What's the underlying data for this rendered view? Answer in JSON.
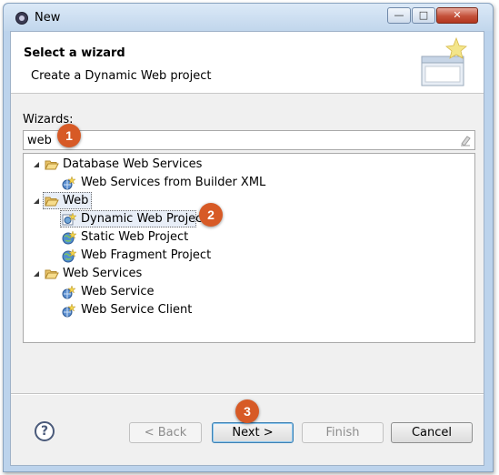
{
  "window": {
    "title": "New"
  },
  "header": {
    "title": "Select a wizard",
    "description": "Create a Dynamic Web project"
  },
  "wizards": {
    "label": "Wizards:",
    "filter_value": "web"
  },
  "tree": {
    "items": [
      {
        "label": "Database Web Services",
        "icon": "folder-open-icon",
        "expanded": true
      },
      {
        "label": "Web Services from Builder XML",
        "icon": "web-service-wizard-icon"
      },
      {
        "label": "Web",
        "icon": "folder-open-icon",
        "expanded": true
      },
      {
        "label": "Dynamic Web Project",
        "icon": "dynamic-web-project-icon",
        "selected": true
      },
      {
        "label": "Static Web Project",
        "icon": "static-web-project-icon"
      },
      {
        "label": "Web Fragment Project",
        "icon": "web-fragment-project-icon"
      },
      {
        "label": "Web Services",
        "icon": "folder-open-icon",
        "expanded": true
      },
      {
        "label": "Web Service",
        "icon": "web-service-wizard-icon"
      },
      {
        "label": "Web Service Client",
        "icon": "web-service-wizard-icon"
      }
    ]
  },
  "buttons": {
    "help": "?",
    "back": "< Back",
    "next": "Next >",
    "finish": "Finish",
    "cancel": "Cancel"
  },
  "callouts": [
    "1",
    "2",
    "3"
  ],
  "colors": {
    "callout": "#d75a26",
    "title_bar": "#c1d6ec",
    "default_button_border": "#3c7fb1"
  }
}
